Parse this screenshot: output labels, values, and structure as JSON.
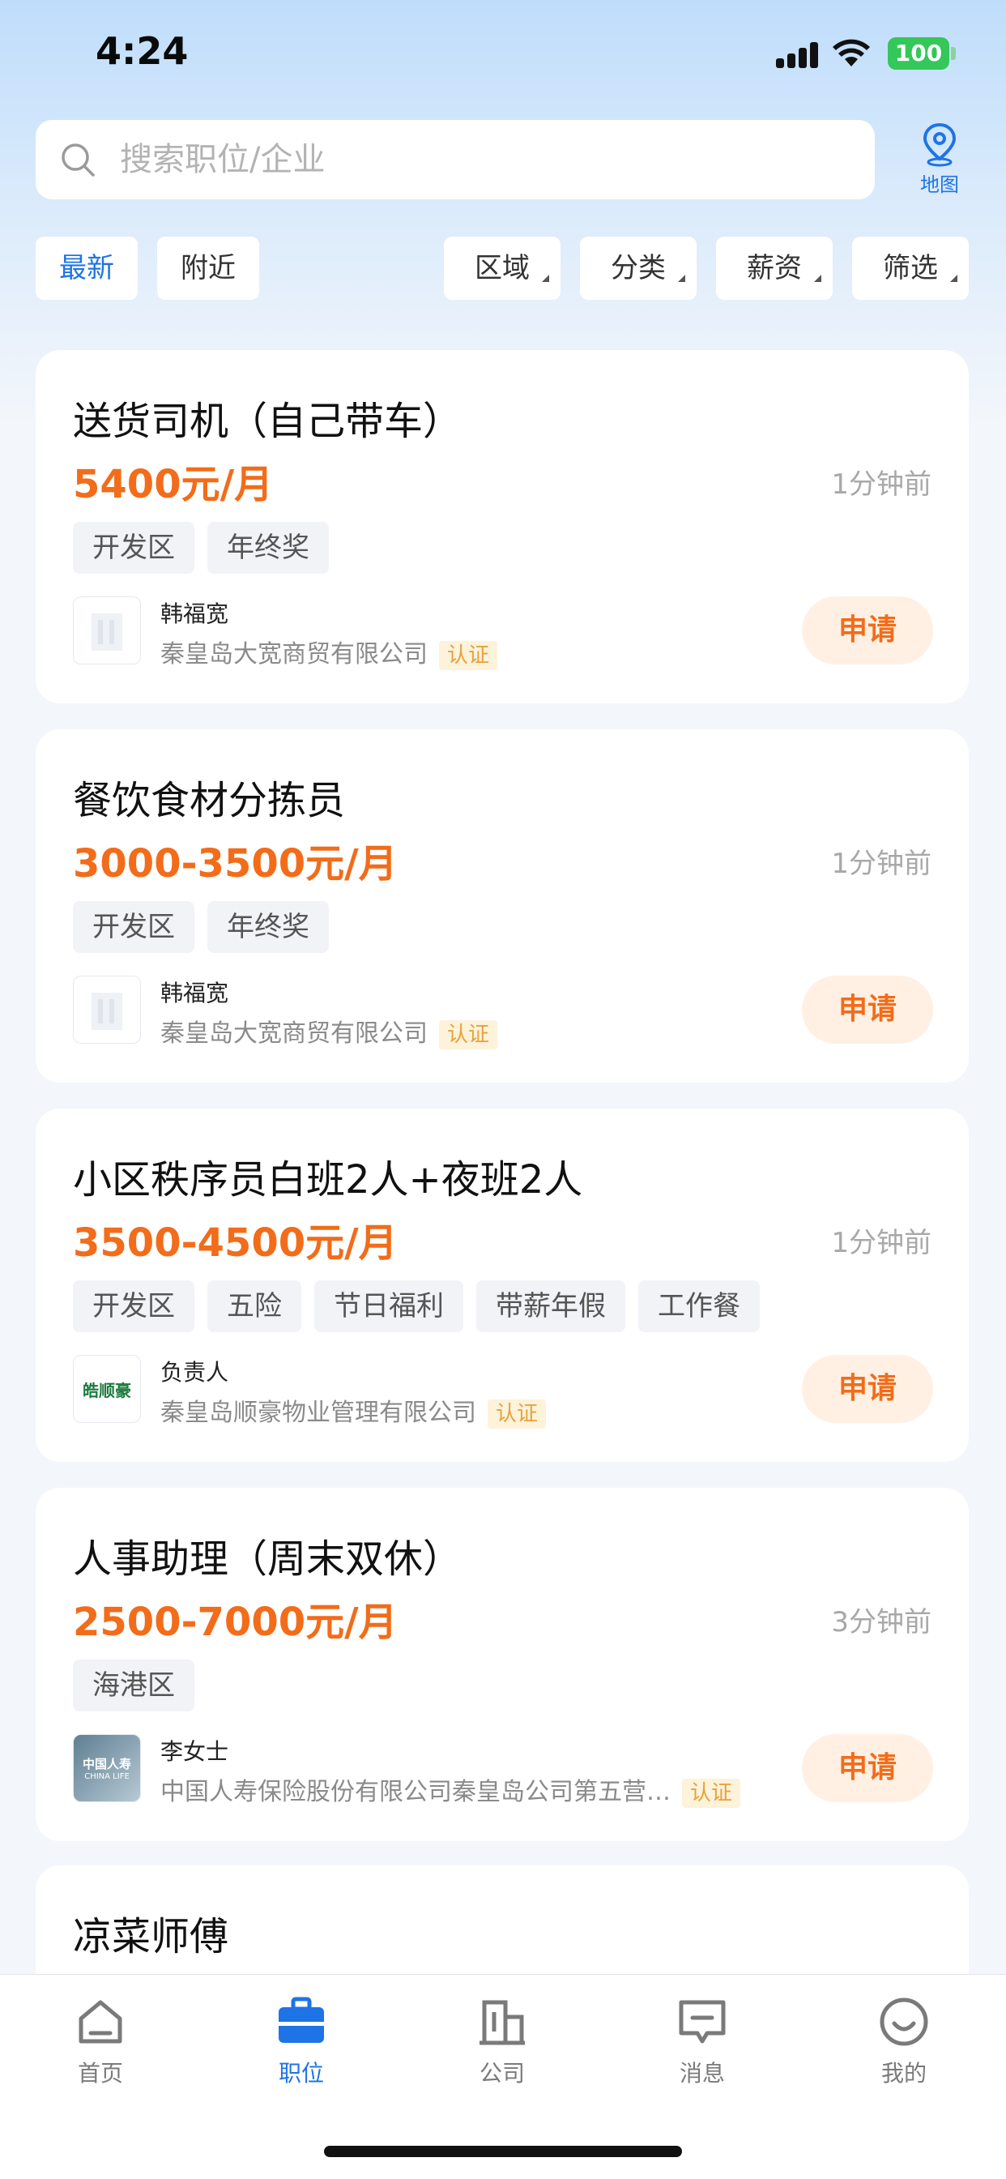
{
  "status_bar": {
    "time": "4:24",
    "battery": "100"
  },
  "search": {
    "placeholder": "搜索职位/企业",
    "map_label": "地图"
  },
  "filters": {
    "left": [
      "最新",
      "附近"
    ],
    "right": [
      "区域",
      "分类",
      "薪资",
      "筛选"
    ],
    "active": "最新"
  },
  "jobs": [
    {
      "title": "送货司机（自己带车）",
      "salary": "5400元/月",
      "time": "1分钟前",
      "tags": [
        "开发区",
        "年终奖"
      ],
      "recruiter": "韩福宽",
      "company": "秦皇岛大宽商贸有限公司",
      "verified": "认证",
      "apply": "申请"
    },
    {
      "title": "餐饮食材分拣员",
      "salary": "3000-3500元/月",
      "time": "1分钟前",
      "tags": [
        "开发区",
        "年终奖"
      ],
      "recruiter": "韩福宽",
      "company": "秦皇岛大宽商贸有限公司",
      "verified": "认证",
      "apply": "申请"
    },
    {
      "title": "小区秩序员白班2人+夜班2人",
      "salary": "3500-4500元/月",
      "time": "1分钟前",
      "tags": [
        "开发区",
        "五险",
        "节日福利",
        "带薪年假",
        "工作餐"
      ],
      "recruiter": "负责人",
      "company": "秦皇岛顺豪物业管理有限公司",
      "verified": "认证",
      "apply": "申请",
      "logo_text": "皓顺豪"
    },
    {
      "title": "人事助理（周末双休）",
      "salary": "2500-7000元/月",
      "time": "3分钟前",
      "tags": [
        "海港区"
      ],
      "recruiter": "李女士",
      "company": "中国人寿保险股份有限公司秦皇岛公司第五营…",
      "verified": "认证",
      "apply": "申请",
      "logo_text": "中国人寿",
      "logo_subtext": "CHINA LIFE"
    }
  ],
  "partial_job": {
    "title": "凉菜师傅"
  },
  "tab_bar": {
    "items": [
      {
        "label": "首页",
        "icon": "home-icon"
      },
      {
        "label": "职位",
        "icon": "briefcase-icon"
      },
      {
        "label": "公司",
        "icon": "building-icon"
      },
      {
        "label": "消息",
        "icon": "message-icon"
      },
      {
        "label": "我的",
        "icon": "smile-icon"
      }
    ],
    "active": "职位"
  },
  "colors": {
    "accent": "#1e74e6",
    "salary": "#f26c1a",
    "verified": "#e6a23c"
  }
}
